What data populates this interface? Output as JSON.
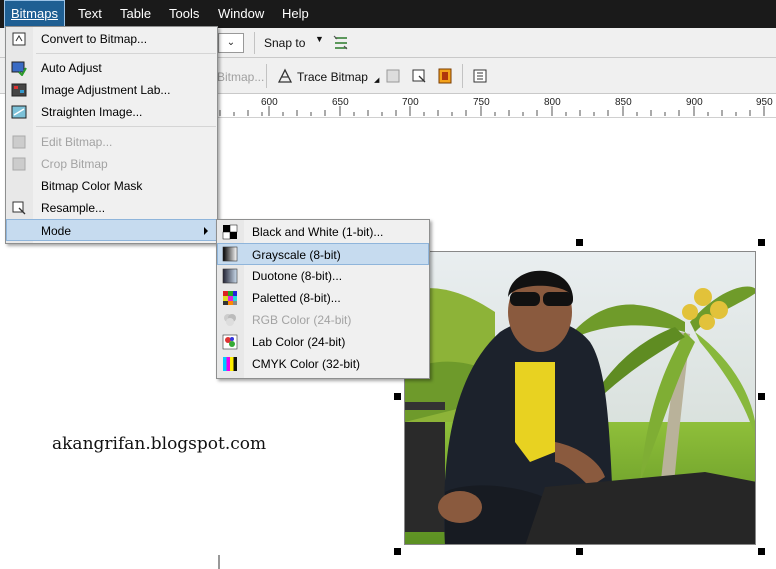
{
  "menubar": {
    "items": [
      {
        "label": "Bitmaps",
        "active": true
      },
      {
        "label": "Text"
      },
      {
        "label": "Table"
      },
      {
        "label": "Tools"
      },
      {
        "label": "Window"
      },
      {
        "label": "Help"
      }
    ]
  },
  "propbar": {
    "snap_label": "Snap to"
  },
  "toolbar2": {
    "edit_bitmap_label": "Bitmap...",
    "trace_bitmap_label": "Trace Bitmap"
  },
  "ruler": {
    "labels": [
      "600",
      "650",
      "700",
      "750",
      "800",
      "850",
      "900",
      "950"
    ]
  },
  "bitmaps_menu": {
    "items": [
      {
        "label": "Convert to Bitmap...",
        "enabled": true,
        "icon": "convert-bitmap-icon"
      },
      {
        "label": "Auto Adjust",
        "enabled": true,
        "icon": "auto-adjust-icon"
      },
      {
        "label": "Image Adjustment Lab...",
        "enabled": true,
        "icon": "adjustment-lab-icon"
      },
      {
        "label": "Straighten Image...",
        "enabled": true,
        "icon": "straighten-icon"
      },
      {
        "label": "Edit Bitmap...",
        "enabled": false,
        "icon": "edit-bitmap-icon"
      },
      {
        "label": "Crop Bitmap",
        "enabled": false,
        "icon": "crop-bitmap-icon"
      },
      {
        "label": "Bitmap Color Mask",
        "enabled": true
      },
      {
        "label": "Resample...",
        "enabled": true,
        "icon": "resample-icon"
      },
      {
        "label": "Mode",
        "enabled": true,
        "highlighted": true,
        "submenu": true
      }
    ]
  },
  "mode_submenu": {
    "items": [
      {
        "label": "Black and White (1-bit)...",
        "enabled": true,
        "icon": "black-white-icon"
      },
      {
        "label": "Grayscale (8-bit)",
        "enabled": true,
        "highlighted": true,
        "icon": "grayscale-icon"
      },
      {
        "label": "Duotone (8-bit)...",
        "enabled": true,
        "icon": "duotone-icon"
      },
      {
        "label": "Paletted (8-bit)...",
        "enabled": true,
        "icon": "paletted-icon"
      },
      {
        "label": "RGB Color (24-bit)",
        "enabled": false,
        "icon": "rgb-icon"
      },
      {
        "label": "Lab Color (24-bit)",
        "enabled": true,
        "icon": "lab-color-icon"
      },
      {
        "label": "CMYK Color (32-bit)",
        "enabled": true,
        "icon": "cmyk-icon"
      }
    ]
  },
  "canvas": {
    "watermark": "akangrifan.blogspot.com"
  },
  "colors": {
    "menubar_bg": "#1a1a1a",
    "menu_bg": "#f0f0f0",
    "highlight": "#c6dbef",
    "active_menu": "#1f5f93"
  }
}
